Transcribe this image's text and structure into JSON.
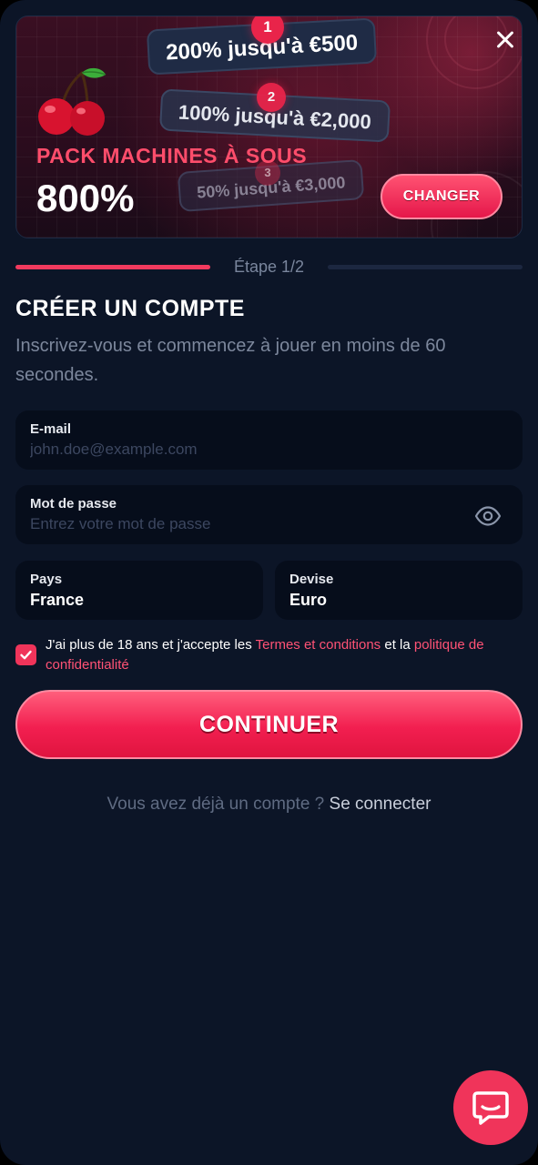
{
  "banner": {
    "offers": [
      {
        "step": "1",
        "label": "200% jusqu'à €500"
      },
      {
        "step": "2",
        "label": "100% jusqu'à €2,000"
      },
      {
        "step": "3",
        "label": "50% jusqu'à €3,000"
      }
    ],
    "pack_title": "PACK MACHINES À SOUS",
    "pack_percent": "800%",
    "change_label": "CHANGER",
    "close_icon": "close-icon",
    "art_icon": "cherry-icon"
  },
  "progress": {
    "step_label": "Étape 1/2",
    "filled_fraction": 0.5
  },
  "form": {
    "title": "CRÉER UN COMPTE",
    "subtitle": "Inscrivez-vous et commencez à jouer en moins de 60 secondes.",
    "email": {
      "label": "E-mail",
      "placeholder": "john.doe@example.com",
      "value": ""
    },
    "password": {
      "label": "Mot de passe",
      "placeholder": "Entrez votre mot de passe",
      "value": "",
      "toggle_icon": "eye-icon"
    },
    "country": {
      "label": "Pays",
      "value": "France"
    },
    "currency": {
      "label": "Devise",
      "value": "Euro"
    },
    "consent": {
      "checked": true,
      "text_1": "J'ai plus de 18 ans et j'accepte les ",
      "terms_link": "Termes et conditions",
      "text_2": " et la ",
      "privacy_link": "politique de confidentialité"
    },
    "continue_label": "CONTINUER"
  },
  "login": {
    "prompt": "Vous avez déjà un compte ? ",
    "link": "Se connecter"
  },
  "chat": {
    "icon": "chat-icon"
  },
  "colors": {
    "background": "#0c1527",
    "accent": "#f0345a",
    "field_bg": "#060d1b",
    "muted_text": "#7c879c"
  }
}
